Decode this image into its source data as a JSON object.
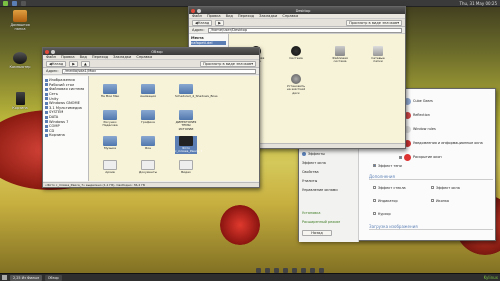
{
  "top_panel": {
    "clock": "Thu, 31 May 00:25"
  },
  "desktop": {
    "items": [
      {
        "label": "Домашняя папка"
      },
      {
        "label": "Компьютер"
      },
      {
        "label": "Корзина"
      }
    ]
  },
  "nautilus": {
    "title": "Desktop",
    "menu": [
      "Файл",
      "Правка",
      "Вид",
      "Переход",
      "Закладки",
      "Справка"
    ],
    "toolbar": [
      "Назад",
      "Вперёд",
      "Просмотр в виде значков"
    ],
    "location_label": "Адрес:",
    "location": "/home/user/Desktop",
    "sidebar_label": "Места",
    "sidebar_item": "nafapeti.del",
    "files": [
      {
        "name": "Домашняя папка"
      },
      {
        "name": "Система"
      },
      {
        "name": "Файловая система"
      },
      {
        "name": "Сетевые папки"
      },
      {
        "name": "Установить на жёсткий диск"
      }
    ],
    "status": "4 объекта, свободно: 3,6 ГБ"
  },
  "fm2": {
    "title": "Обзор",
    "menu": [
      "Файл",
      "Правка",
      "Вид",
      "Переход",
      "Закладки",
      "Справка"
    ],
    "toolbar": [
      "Назад",
      "Вперёд",
      "Просмотр в виде значков"
    ],
    "location_label": "Адрес:",
    "location": "/media/sda1/Мои",
    "sidebar": [
      "Изображения",
      "Рабочий стол",
      "Файловая система",
      "Сеть",
      "Unity",
      "Windows GNOME",
      "3.1 Мультимедиа",
      "SYSTEM",
      "DATA",
      "Windows 7",
      "COMP",
      "CD",
      "Корзина"
    ],
    "files": [
      {
        "name": "На Мои Мак"
      },
      {
        "name": "Анимация"
      },
      {
        "name": "Scheduled_4_Shadows_Boss"
      },
      {
        "name": "Рисунки Надасова"
      },
      {
        "name": "Графика"
      },
      {
        "name": "ДИРЕКТОРИЯ ТЕМЫ ИСТОРИИ"
      },
      {
        "name": "Музыка"
      },
      {
        "name": "Фон"
      },
      {
        "name": "Фото с_пляжа_Раиса_7"
      },
      {
        "name": "Архив"
      },
      {
        "name": "Документы"
      },
      {
        "name": "Видео"
      }
    ],
    "status": "«Фото с_пляжа_Раиса_7» выделено (1,1 ГБ), Свободно: 36,2 ГБ"
  },
  "settings": {
    "sections": [
      "Эффекты",
      "Эффект окна",
      "Свойства",
      "Утилиты",
      "Управление окнами",
      "Дополнения",
      "Установка",
      "Расширенный режим"
    ],
    "section_heading": "Дополнения",
    "items": [
      {
        "label": "Эффект тени",
        "checked": true
      },
      {
        "label": "Эффект стекла",
        "checked": false
      },
      {
        "label": "Эффект окна",
        "checked": false
      },
      {
        "label": "Индикатор",
        "checked": false
      },
      {
        "label": "Иконка",
        "checked": false
      },
      {
        "label": "Курсор",
        "checked": false
      }
    ],
    "right_items": [
      {
        "label": "Cube Gears"
      },
      {
        "label": "Reflection"
      },
      {
        "label": "Window rules"
      },
      {
        "label": "Уведомления и информационные окна"
      },
      {
        "label": "Раскрытие окон"
      }
    ],
    "footer_section": "Загрузка изображения",
    "back": "Назад"
  },
  "taskbar": {
    "tasks": [
      "2,25 Из Фильм",
      "Обзор"
    ],
    "logo": "Kylinux"
  }
}
